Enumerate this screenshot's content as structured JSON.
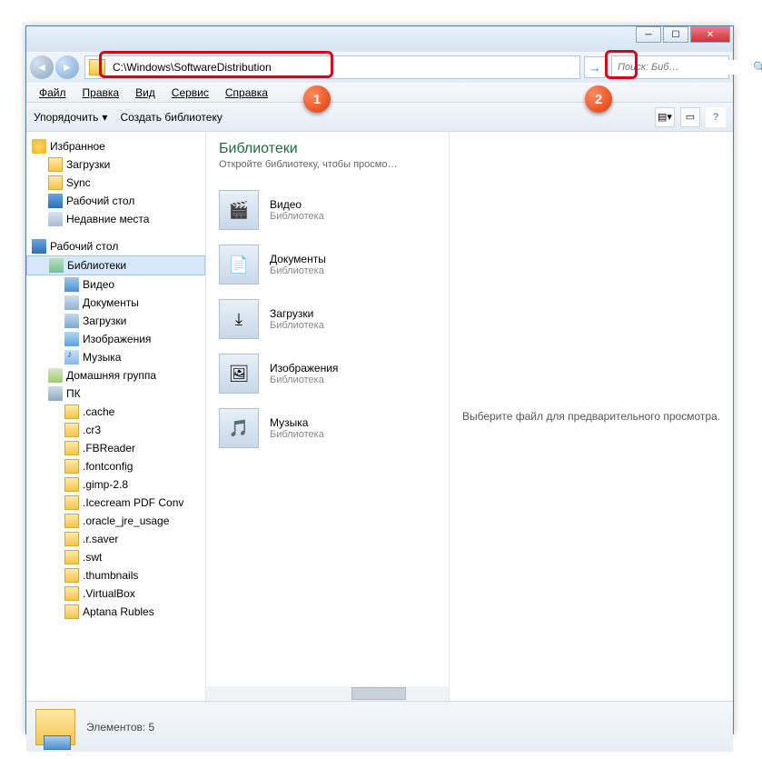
{
  "address_bar": {
    "path": "C:\\Windows\\SoftwareDistribution"
  },
  "search": {
    "placeholder": "Поиск: Биб…"
  },
  "menu": {
    "file": "Файл",
    "edit": "Правка",
    "view": "Вид",
    "tools": "Сервис",
    "help": "Справка"
  },
  "toolbar": {
    "organize": "Упорядочить",
    "new_lib": "Создать библиотеку"
  },
  "sidebar": {
    "favorites": {
      "label": "Избранное",
      "items": [
        {
          "label": "Загрузки",
          "icon": "folder"
        },
        {
          "label": "Sync",
          "icon": "folder"
        },
        {
          "label": "Рабочий стол",
          "icon": "desktop"
        },
        {
          "label": "Недавние места",
          "icon": "recent"
        }
      ]
    },
    "desktop": {
      "label": "Рабочий стол"
    },
    "libraries": {
      "label": "Библиотеки",
      "items": [
        {
          "label": "Видео",
          "icon": "video"
        },
        {
          "label": "Документы",
          "icon": "doc"
        },
        {
          "label": "Загрузки",
          "icon": "dl"
        },
        {
          "label": "Изображения",
          "icon": "img"
        },
        {
          "label": "Музыка",
          "icon": "music"
        }
      ]
    },
    "homegroup": {
      "label": "Домашняя группа"
    },
    "pc": {
      "label": "ПК",
      "items": [
        ".cache",
        ".cr3",
        ".FBReader",
        ".fontconfig",
        ".gimp-2.8",
        ".Icecream PDF Conv",
        ".oracle_jre_usage",
        ".r.saver",
        ".swt",
        ".thumbnails",
        ".VirtualBox",
        "Aptana Rubles"
      ]
    }
  },
  "content": {
    "title": "Библиотеки",
    "subtitle": "Откройте библиотеку, чтобы просмо…",
    "items": [
      {
        "name": "Видео",
        "type": "Библиотека",
        "glyph": "🎬"
      },
      {
        "name": "Документы",
        "type": "Библиотека",
        "glyph": "📄"
      },
      {
        "name": "Загрузки",
        "type": "Библиотека",
        "glyph": "⤓"
      },
      {
        "name": "Изображения",
        "type": "Библиотека",
        "glyph": "🖼"
      },
      {
        "name": "Музыка",
        "type": "Библиотека",
        "glyph": "🎵"
      }
    ]
  },
  "preview": {
    "empty": "Выберите файл для предварительного просмотра."
  },
  "status": {
    "label": "Элементов:",
    "count": "5"
  },
  "annotations": {
    "b1": "1",
    "b2": "2"
  }
}
